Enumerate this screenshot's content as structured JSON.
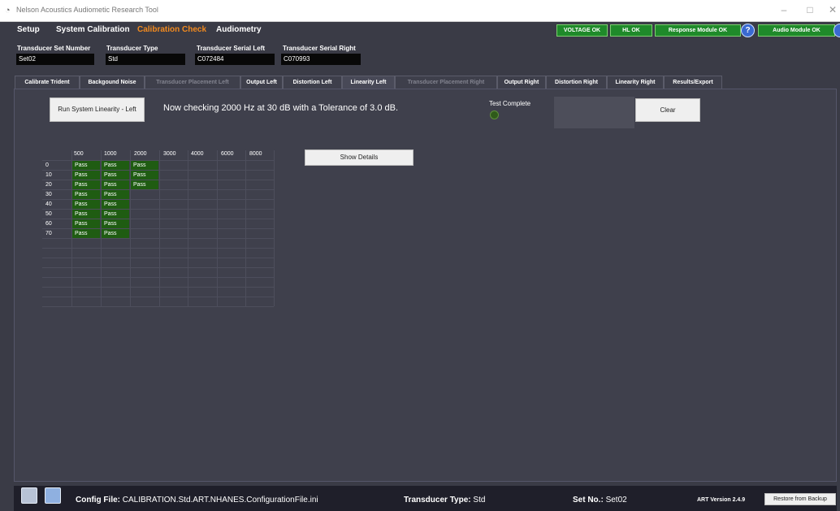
{
  "window": {
    "title": "Nelson Acoustics Audiometic Research Tool"
  },
  "menu": [
    {
      "label": "Setup"
    },
    {
      "label": "System Calibration"
    },
    {
      "label": "Calibration Check"
    },
    {
      "label": "Audiometry"
    }
  ],
  "status": {
    "voltage": "VOLTAGE OK",
    "hl": "HL OK",
    "response": "Response Module OK",
    "audio": "Audio Module OK",
    "help": "?"
  },
  "fields": {
    "set_number": {
      "label": "Transducer Set Number",
      "value": "Set02"
    },
    "type": {
      "label": "Transducer Type",
      "value": "Std"
    },
    "serial_left": {
      "label": "Transducer Serial Left",
      "value": "C072484"
    },
    "serial_right": {
      "label": "Transducer Serial Right",
      "value": "C070993"
    }
  },
  "tabs": [
    {
      "label": "Calibrate Trident"
    },
    {
      "label": "Backgound Noise"
    },
    {
      "label": "Transducer Placement Left"
    },
    {
      "label": "Output Left"
    },
    {
      "label": "Distortion Left"
    },
    {
      "label": "Linearity Left"
    },
    {
      "label": "Transducer Placement Right"
    },
    {
      "label": "Output Right"
    },
    {
      "label": "Distortion Right"
    },
    {
      "label": "Linearity Right"
    },
    {
      "label": "Results/Export"
    }
  ],
  "linearity": {
    "run_button": "Run System Linearity - Left",
    "message": "Now checking 2000 Hz at 30 dB with a Tolerance of 3.0 dB.",
    "test_complete_label": "Test Complete",
    "clear_button": "Clear",
    "show_details_button": "Show Details",
    "freq_headers": [
      "500",
      "1000",
      "2000",
      "3000",
      "4000",
      "6000",
      "8000"
    ],
    "levels": [
      "0",
      "10",
      "20",
      "30",
      "40",
      "50",
      "60",
      "70"
    ],
    "results": [
      [
        "Pass",
        "Pass",
        "Pass",
        "",
        "",
        "",
        ""
      ],
      [
        "Pass",
        "Pass",
        "Pass",
        "",
        "",
        "",
        ""
      ],
      [
        "Pass",
        "Pass",
        "Pass",
        "",
        "",
        "",
        ""
      ],
      [
        "Pass",
        "Pass",
        "",
        "",
        "",
        "",
        ""
      ],
      [
        "Pass",
        "Pass",
        "",
        "",
        "",
        "",
        ""
      ],
      [
        "Pass",
        "Pass",
        "",
        "",
        "",
        "",
        ""
      ],
      [
        "Pass",
        "Pass",
        "",
        "",
        "",
        "",
        ""
      ],
      [
        "Pass",
        "Pass",
        "",
        "",
        "",
        "",
        ""
      ]
    ]
  },
  "bottom": {
    "config_label": "Config File:",
    "config_value": "CALIBRATION.Std.ART.NHANES.ConfigurationFile.ini",
    "type_label": "Transducer Type:",
    "type_value": "Std",
    "set_label": "Set No.:",
    "set_value": "Set02",
    "version": "ART Version 2.4.9",
    "restore_button": "Restore from Backup"
  },
  "colors": {
    "accent": "#f28a1f",
    "status_ok": "#1f8a2a",
    "pass_cell": "#1f5c12",
    "background": "#3a3b46"
  }
}
